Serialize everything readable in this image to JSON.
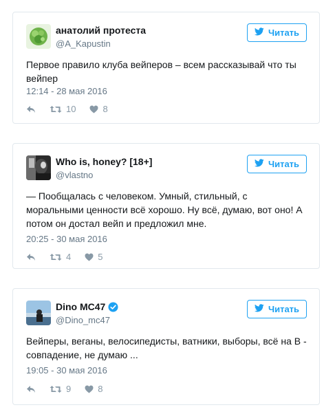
{
  "tweets": [
    {
      "name": "анатолий протеста",
      "handle": "@A_Kapustin",
      "follow_label": "Читать",
      "text": "Первое правило клуба вейперов – всем рассказывай что ты вейпер",
      "timestamp": "12:14 - 28 мая 2016",
      "retweets": "10",
      "likes": "8",
      "verified": false
    },
    {
      "name": "Who is, honey? [18+]",
      "handle": "@vlastno",
      "follow_label": "Читать",
      "text": "— Пообщалась с человеком. Умный, стильный, с моральными ценности всё хорошо. Ну всё, думаю, вот оно! А потом он достал вейп и предложил мне.",
      "timestamp": "20:25 - 30 мая 2016",
      "retweets": "4",
      "likes": "5",
      "verified": false
    },
    {
      "name": "Dino MC47",
      "handle": "@Dino_mc47",
      "follow_label": "Читать",
      "text": "Вейперы, веганы, велосипедисты, ватники, выборы, всё на В - совпадение, не думаю ...",
      "timestamp": "19:05 - 30 мая 2016",
      "retweets": "9",
      "likes": "8",
      "verified": true
    }
  ],
  "colors": {
    "accent": "#1da1f2",
    "muted": "#657786",
    "icon": "#8899a6",
    "border": "#e1e8ed"
  },
  "icons": [
    "twitter-bird-icon",
    "reply-icon",
    "retweet-icon",
    "heart-icon",
    "verified-badge-icon"
  ]
}
